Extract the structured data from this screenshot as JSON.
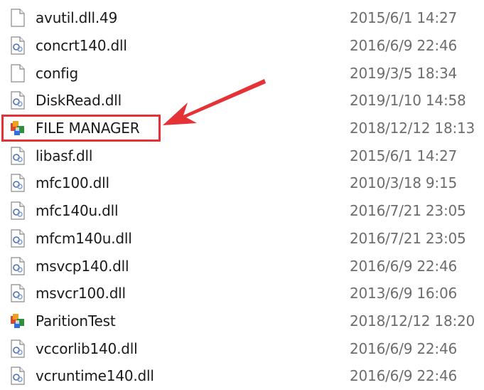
{
  "files": [
    {
      "name": "avutil.dll.49",
      "date": "2015/6/1 14:27",
      "icon": "blank-file-icon"
    },
    {
      "name": "concrt140.dll",
      "date": "2016/6/9 22:46",
      "icon": "dll-file-icon"
    },
    {
      "name": "config",
      "date": "2019/3/5 18:34",
      "icon": "blank-file-icon"
    },
    {
      "name": "DiskRead.dll",
      "date": "2019/1/10 14:58",
      "icon": "dll-file-icon"
    },
    {
      "name": "FILE MANAGER",
      "date": "2018/12/12 18:13",
      "icon": "application-icon"
    },
    {
      "name": "libasf.dll",
      "date": "2015/6/1 14:27",
      "icon": "dll-file-icon"
    },
    {
      "name": "mfc100.dll",
      "date": "2010/3/18 9:15",
      "icon": "dll-file-icon"
    },
    {
      "name": "mfc140u.dll",
      "date": "2016/7/21 23:05",
      "icon": "dll-file-icon"
    },
    {
      "name": "mfcm140u.dll",
      "date": "2016/7/21 23:05",
      "icon": "dll-file-icon"
    },
    {
      "name": "msvcp140.dll",
      "date": "2016/6/9 22:46",
      "icon": "dll-file-icon"
    },
    {
      "name": "msvcr100.dll",
      "date": "2013/6/9 16:06",
      "icon": "dll-file-icon"
    },
    {
      "name": "ParitionTest",
      "date": "2018/12/12 18:20",
      "icon": "application-icon"
    },
    {
      "name": "vccorlib140.dll",
      "date": "2016/6/9 22:46",
      "icon": "dll-file-icon"
    },
    {
      "name": "vcruntime140.dll",
      "date": "2016/6/9 22:46",
      "icon": "dll-file-icon"
    }
  ],
  "annotation": {
    "highlighted_file": "FILE MANAGER",
    "color": "#e53237"
  }
}
